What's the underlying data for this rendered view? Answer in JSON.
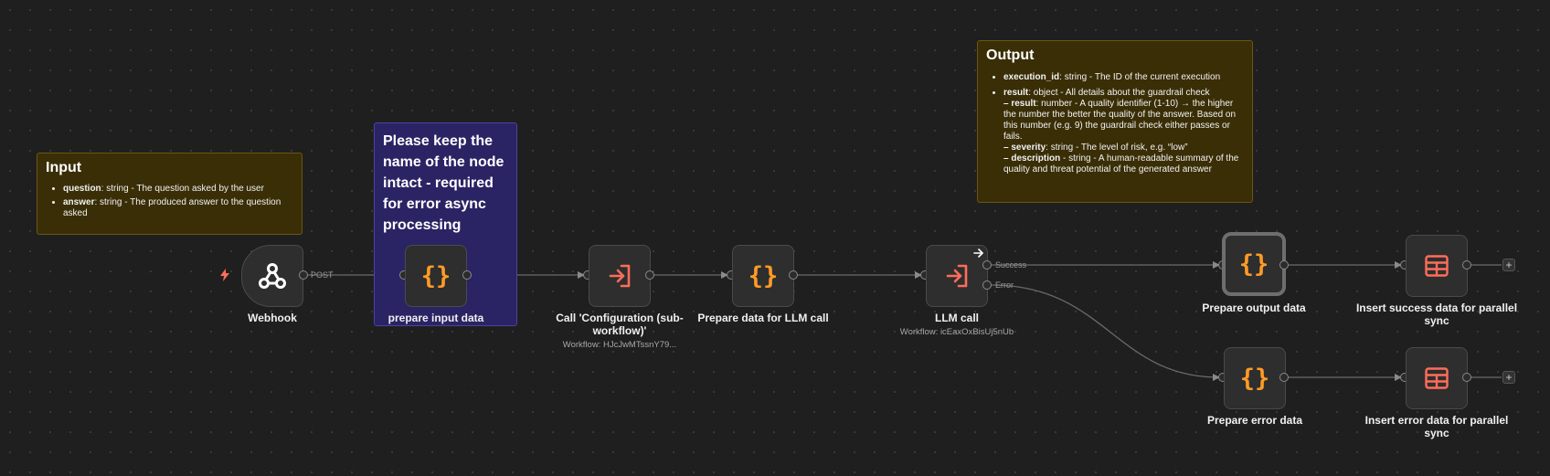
{
  "notes": {
    "input": {
      "title": "Input",
      "items": [
        {
          "key": "question",
          "text": ": string - The question asked by the user"
        },
        {
          "key": "answer",
          "text": ": string - The produced answer to the question asked"
        }
      ]
    },
    "keep_name": {
      "text": "Please keep the name of the node intact - required for error async processing"
    },
    "output": {
      "title": "Output",
      "execution_id_key": "execution_id",
      "execution_id_text": ": string - The ID of the current execution",
      "result_key": "result",
      "result_text": ": object - All details about the guardrail check",
      "sub_result_key": "– result",
      "sub_result_text": ": number - A quality identifier (1-10) → the higher the number the better the quality of the answer. Based on this number (e.g. 9) the guardrail check either passes or fails.",
      "sub_severity_key": "– severity",
      "sub_severity_text": ": string - The level of risk, e.g. “low”",
      "sub_description_key": "– description",
      "sub_description_text": " - string - A human-readable summary of the quality and threat potential of the generated answer"
    }
  },
  "nodes": {
    "webhook": {
      "label": "Webhook",
      "icon": "webhook-icon"
    },
    "prepare_input": {
      "label": "prepare input data",
      "icon": "code-braces-icon"
    },
    "call_config": {
      "label": "Call 'Configuration (sub-workflow)'",
      "sublabel": "Workflow: HJcJwMTssnY79...",
      "icon": "execute-workflow-icon"
    },
    "prepare_llm": {
      "label": "Prepare data for LLM call",
      "icon": "code-braces-icon"
    },
    "llm_call": {
      "label": "LLM call",
      "sublabel": "Workflow: icEaxOxBisUj5nUb",
      "icon": "execute-workflow-icon"
    },
    "prepare_output": {
      "label": "Prepare output data",
      "icon": "code-braces-icon"
    },
    "insert_success": {
      "label": "Insert success data for parallel sync",
      "icon": "table-icon"
    },
    "prepare_error": {
      "label": "Prepare error data",
      "icon": "code-braces-icon"
    },
    "insert_error": {
      "label": "Insert error data for parallel sync",
      "icon": "table-icon"
    }
  },
  "connections": {
    "post_label": "POST",
    "success_label": "Success",
    "error_label": "Error",
    "add_symbol": "+"
  },
  "colors": {
    "canvas": "#1f1f1f",
    "node": "#2e2e2e",
    "sticky_yellow": "#3a2e06",
    "sticky_purple": "#2a2464",
    "code_icon": "#ff9b26",
    "execute_icon": "#ff6d5a",
    "table_icon": "#ff6d5a",
    "trigger_bolt": "#ff6d5a"
  }
}
